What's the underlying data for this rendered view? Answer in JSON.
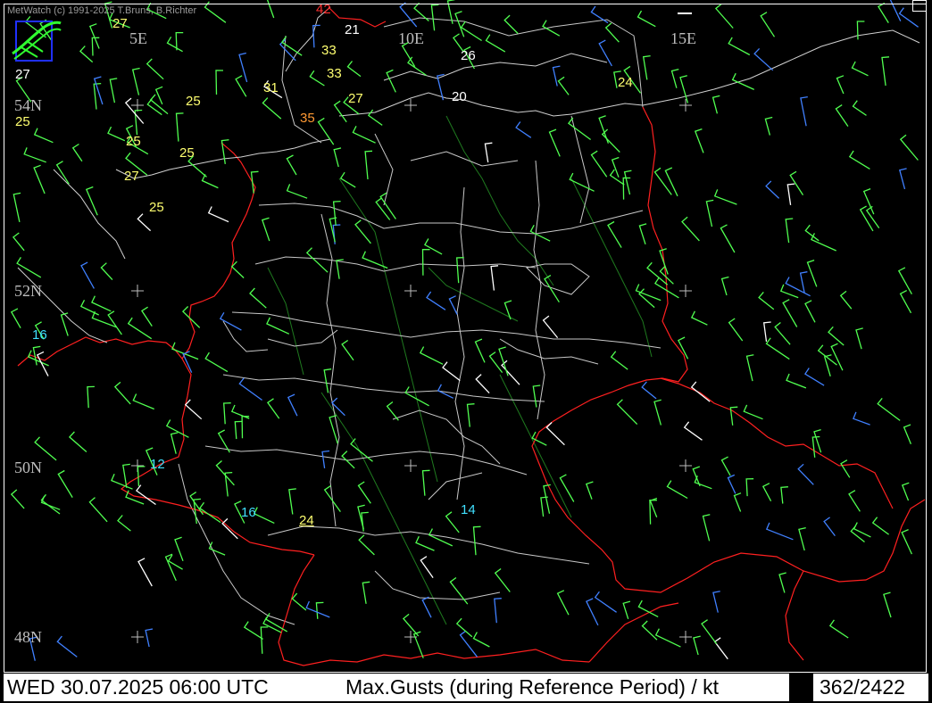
{
  "copyright": "MetWatch  (c) 1991-2025 T.Bruns, B.Richter",
  "grid_labels": {
    "lon": [
      "5E",
      "10E",
      "15E"
    ],
    "lat": [
      "54N",
      "52N",
      "50N",
      "48N"
    ]
  },
  "stations": [
    {
      "value": "42",
      "color": "#ff3030"
    },
    {
      "value": "27",
      "color": "#ffff70"
    },
    {
      "value": "21",
      "color": "#ffffff"
    },
    {
      "value": "33",
      "color": "#ffff70"
    },
    {
      "value": "33",
      "color": "#ffff70"
    },
    {
      "value": "26",
      "color": "#ffffff"
    },
    {
      "value": "27",
      "color": "#ffffff"
    },
    {
      "value": "31",
      "color": "#ffff70"
    },
    {
      "value": "27",
      "color": "#ffff70"
    },
    {
      "value": "20",
      "color": "#ffffff"
    },
    {
      "value": "24",
      "color": "#ffff70"
    },
    {
      "value": "25",
      "color": "#ffff70"
    },
    {
      "value": "25",
      "color": "#ffff70"
    },
    {
      "value": "35",
      "color": "#ff9933"
    },
    {
      "value": "25",
      "color": "#ffff70"
    },
    {
      "value": "25",
      "color": "#ffff70"
    },
    {
      "value": "27",
      "color": "#ffff70"
    },
    {
      "value": "25",
      "color": "#ffff70"
    },
    {
      "value": "16",
      "color": "#40e0ff"
    },
    {
      "value": "12",
      "color": "#40e0ff"
    },
    {
      "value": "16",
      "color": "#40e0ff"
    },
    {
      "value": "24",
      "color": "#ffff70"
    },
    {
      "value": "14",
      "color": "#40e0ff"
    }
  ],
  "colors": {
    "border_country": "#ff2020",
    "border_state": "#c8c8c8",
    "rivers": "#1f7a1f",
    "barb_green": "#50ff50",
    "barb_blue": "#4080ff",
    "barb_white": "#ffffff"
  },
  "status": {
    "time": "WED 30.07.2025 06:00 UTC",
    "title": "Max.Gusts (during Reference Period) / kt",
    "count": "362/2422"
  },
  "icons": [
    "metwatch-logo-icon",
    "close-icon",
    "minimize-icon"
  ]
}
